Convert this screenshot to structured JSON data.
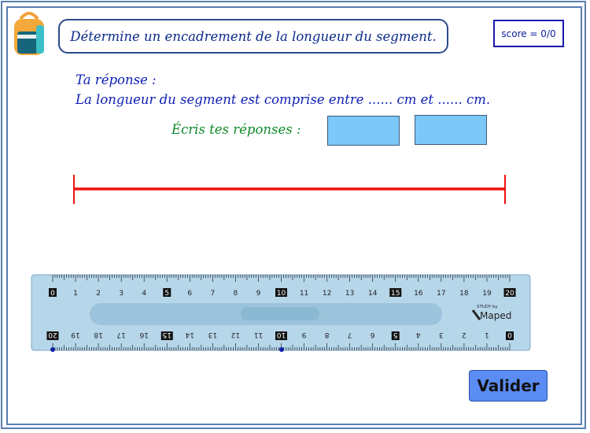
{
  "instruction": "Détermine un encadrement de la longueur du segment.",
  "score": "score = 0/0",
  "answer": {
    "line1": "Ta réponse :",
    "line2": "La longueur du segment est comprise entre ...... cm et ...... cm."
  },
  "hint": "Écris tes réponses :",
  "inputs": [
    {
      "value": "",
      "placeholder": ""
    },
    {
      "value": "",
      "placeholder": ""
    }
  ],
  "ruler": {
    "top_numbers": [
      "0",
      "1",
      "2",
      "3",
      "4",
      "5",
      "6",
      "7",
      "8",
      "9",
      "10",
      "11",
      "12",
      "13",
      "14",
      "15",
      "16",
      "17",
      "18",
      "19",
      "20"
    ],
    "bottom_numbers": [
      "20",
      "19",
      "18",
      "17",
      "16",
      "15",
      "14",
      "13",
      "12",
      "11",
      "10",
      "9",
      "8",
      "7",
      "6",
      "5",
      "4",
      "3",
      "2",
      "1",
      "0"
    ],
    "brand_small": "STUDY by",
    "brand": "Maped"
  },
  "button": {
    "valider": "Valider"
  },
  "colors": {
    "frame": "#5a7fb0",
    "segment": "#ee1111",
    "ruler": "#b6d6ea",
    "button": "#5a8cf4"
  }
}
